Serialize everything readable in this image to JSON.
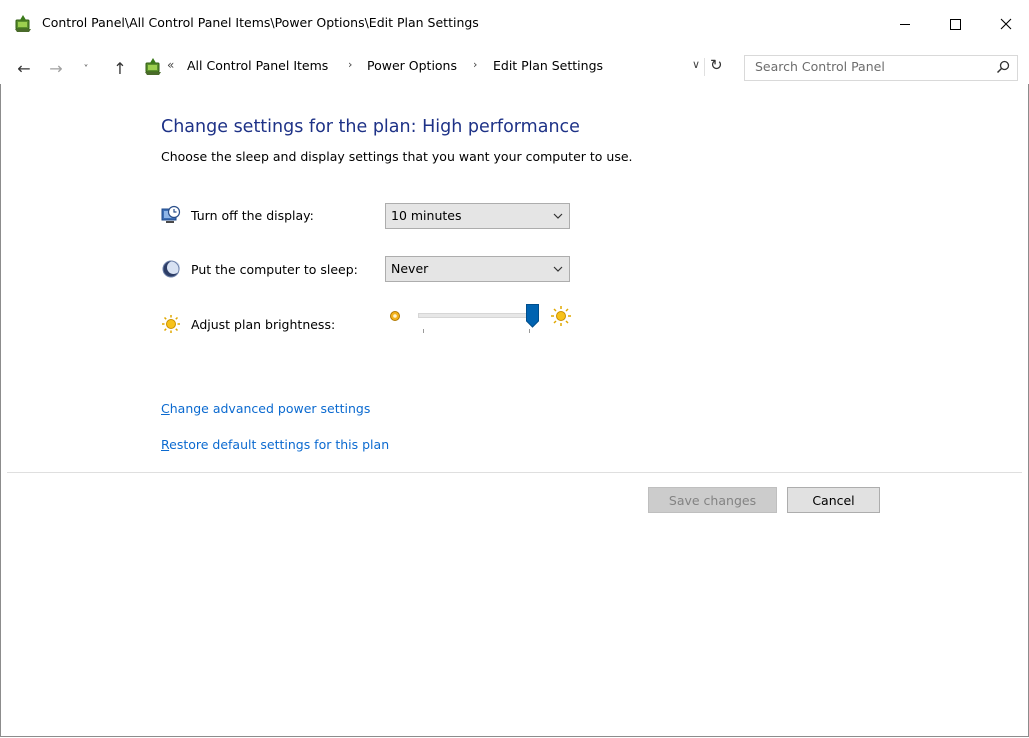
{
  "window": {
    "title": "Control Panel\\All Control Panel Items\\Power Options\\Edit Plan Settings",
    "icons": {
      "app": "power-options-icon",
      "minimize": "minimize-icon",
      "maximize": "maximize-icon",
      "close": "close-icon"
    }
  },
  "nav": {
    "back": "←",
    "forward": "→",
    "recent": "˅",
    "up": "↑",
    "overflow": "«",
    "breadcrumbs": [
      "All Control Panel Items",
      "Power Options",
      "Edit Plan Settings"
    ],
    "separator": "›",
    "dropdown": "∨",
    "refresh": "↻",
    "search_placeholder": "Search Control Panel"
  },
  "main": {
    "heading": "Change settings for the plan: High performance",
    "description": "Choose the sleep and display settings that you want your computer to use.",
    "settings": [
      {
        "label": "Turn off the display:",
        "value": "10 minutes",
        "icon": "display-timer-icon"
      },
      {
        "label": "Put the computer to sleep:",
        "value": "Never",
        "icon": "moon-sleep-icon"
      }
    ],
    "brightness": {
      "label": "Adjust plan brightness:",
      "level": 0.97,
      "icon": "brightness-sun-icon"
    },
    "links": {
      "advanced": "Change advanced power settings",
      "restore": "Restore default settings for this plan"
    }
  },
  "footer": {
    "save_label": "Save changes",
    "cancel_label": "Cancel"
  },
  "colors": {
    "heading": "#1e3287",
    "link": "#0b6ad0",
    "slider_thumb": "#0063b1"
  }
}
